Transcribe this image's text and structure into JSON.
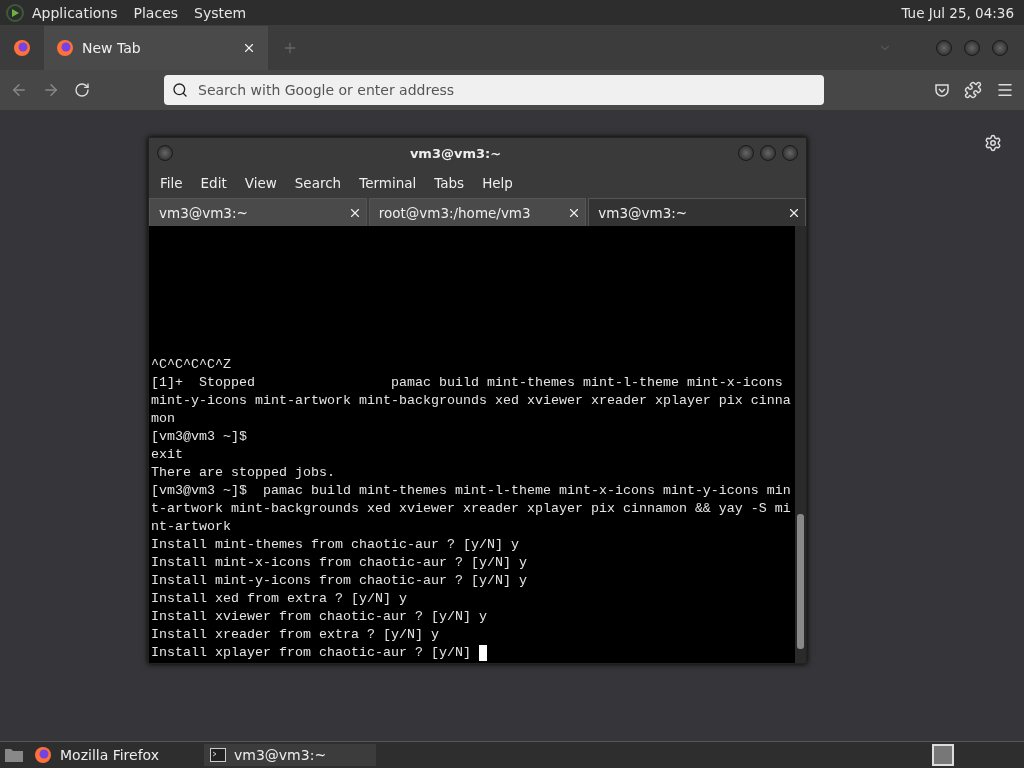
{
  "top_panel": {
    "menus": [
      "Applications",
      "Places",
      "System"
    ],
    "clock": "Tue Jul 25, 04:36"
  },
  "browser": {
    "tabs": [
      {
        "label": "New Tab",
        "selected": true
      }
    ],
    "address_bar": {
      "placeholder": "Search with Google or enter address"
    }
  },
  "terminal": {
    "title": "vm3@vm3:~",
    "menus": [
      "File",
      "Edit",
      "View",
      "Search",
      "Terminal",
      "Tabs",
      "Help"
    ],
    "tabs": [
      {
        "label": "vm3@vm3:~",
        "selected": false
      },
      {
        "label": "root@vm3:/home/vm3",
        "selected": false
      },
      {
        "label": "vm3@vm3:~",
        "selected": true
      }
    ],
    "lines": [
      "^C^C^C^C^Z",
      "[1]+  Stopped                 pamac build mint-themes mint-l-theme mint-x-icons",
      "mint-y-icons mint-artwork mint-backgrounds xed xviewer xreader xplayer pix cinna",
      "mon",
      "[vm3@vm3 ~]$",
      "exit",
      "There are stopped jobs.",
      "[vm3@vm3 ~]$  pamac build mint-themes mint-l-theme mint-x-icons mint-y-icons min",
      "t-artwork mint-backgrounds xed xviewer xreader xplayer pix cinnamon && yay -S mi",
      "nt-artwork",
      "Install mint-themes from chaotic-aur ? [y/N] y",
      "Install mint-x-icons from chaotic-aur ? [y/N] y",
      "Install mint-y-icons from chaotic-aur ? [y/N] y",
      "Install xed from extra ? [y/N] y",
      "Install xviewer from chaotic-aur ? [y/N] y",
      "Install xreader from extra ? [y/N] y",
      "Install xplayer from chaotic-aur ? [y/N] "
    ]
  },
  "taskbar": {
    "items": [
      {
        "label": "Mozilla Firefox",
        "selected": false,
        "kind": "browser"
      },
      {
        "label": "vm3@vm3:~",
        "selected": true,
        "kind": "terminal"
      }
    ]
  }
}
